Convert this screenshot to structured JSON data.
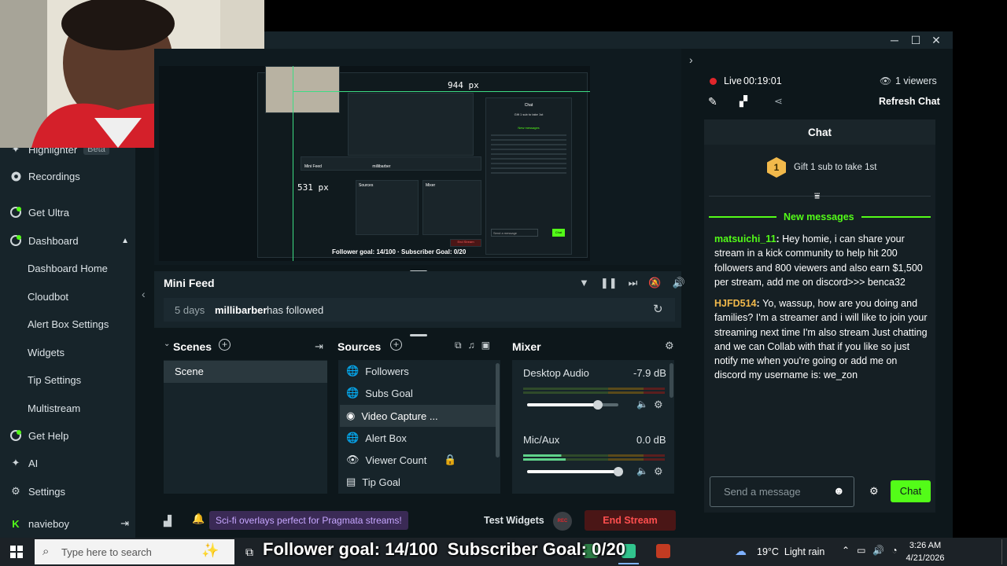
{
  "window": {
    "minimize": "─",
    "maximize": "☐",
    "close": "✕"
  },
  "sidebar": {
    "highlighter_label": "Highlighter",
    "highlighter_badge": "Beta",
    "items": [
      {
        "label": "Recordings"
      },
      {
        "label": "Get Ultra"
      },
      {
        "label": "Dashboard"
      }
    ],
    "dashboard_sub": [
      "Dashboard Home",
      "Cloudbot",
      "Alert Box Settings",
      "Widgets",
      "Tip Settings",
      "Multistream"
    ],
    "bottom_items": [
      {
        "label": "Get Help"
      },
      {
        "label": "AI"
      },
      {
        "label": "Settings"
      }
    ],
    "user": "navieboy"
  },
  "preview": {
    "width_readout": "944 px",
    "height_readout": "531 px",
    "mini_follower": "Follower goal: 14/100 · Subscriber Goal: 0/20",
    "mini_chat_title": "Chat",
    "mini_gift": "Gift 1 sub to take 1st",
    "mini_new": "New messages",
    "mini_mini_feed": "Mini Feed",
    "mini_feed_user": "millibarber",
    "mini_sources": "Sources",
    "mini_mixer": "Mixer",
    "mini_send": "Send a message",
    "mini_chat_btn": "Chat",
    "mini_end": "End Stream"
  },
  "minifeed": {
    "title": "Mini Feed",
    "time": "5 days",
    "user": "millibarber",
    "action": "has followed"
  },
  "scenes": {
    "title": "Scenes",
    "items": [
      "Scene"
    ]
  },
  "sources": {
    "title": "Sources",
    "items": [
      {
        "label": "Followers",
        "icon": "globe-icon"
      },
      {
        "label": "Subs Goal",
        "icon": "globe-icon"
      },
      {
        "label": "Video Capture ...",
        "icon": "webcam-icon"
      },
      {
        "label": "Alert Box",
        "icon": "globe-icon"
      },
      {
        "label": "Viewer Count",
        "icon": "eye-icon"
      },
      {
        "label": "Tip Goal",
        "icon": "document-icon"
      }
    ]
  },
  "mixer": {
    "title": "Mixer",
    "channels": [
      {
        "name": "Desktop Audio",
        "level": "-7.9 dB",
        "volume": 0.78
      },
      {
        "name": "Mic/Aux",
        "level": "0.0 dB",
        "volume": 1.0
      }
    ]
  },
  "footer": {
    "promo": "Sci-fi overlays perfect for Pragmata streams!",
    "test_widgets": "Test Widgets",
    "rec": "REC",
    "end_stream": "End Stream"
  },
  "chat": {
    "live_label": "Live",
    "timer": "00:19:01",
    "viewers": "1 viewers",
    "refresh": "Refresh Chat",
    "title": "Chat",
    "gift_rank": "1",
    "gift_text": "Gift 1 sub to take 1st",
    "new_messages": "New messages",
    "messages": [
      {
        "user": "matsuichi_11",
        "user_color": "#53fc18",
        "text": "Hey homie, i can share your stream in a kick community to help hit 200 followers and 800 viewers and also earn $1,500 per stream, add me on discord>>> benca32"
      },
      {
        "user": "HJFD514",
        "user_color": "#f2b94b",
        "text": "Yo, wassup, how are you doing and families? I'm a streamer and i will like to join your streaming next time I'm also stream Just chatting and we can Collab with that if you like so just notify me when you're going or add me on discord my username is: we_zon"
      }
    ],
    "placeholder": "Send a message",
    "send_label": "Chat"
  },
  "overlay": {
    "goal_text": "Follower goal: 14/100  Subscriber Goal: 0/20"
  },
  "taskbar": {
    "search_placeholder": "Type here to search",
    "weather": "19°C  Light rain",
    "time": "3:26 AM",
    "date": "4/21/2026"
  },
  "colors": {
    "accent": "#53fc18",
    "live": "#e0262b",
    "end_stream": "#ff4f4f",
    "promo_bg": "#3a2a55"
  }
}
